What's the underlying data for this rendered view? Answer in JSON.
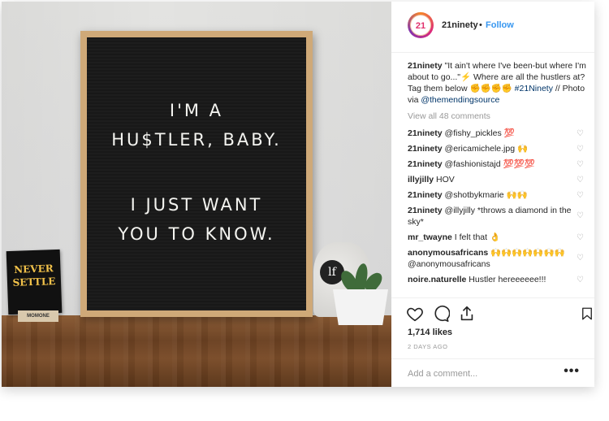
{
  "post": {
    "board_lines": [
      "I'M A",
      "HU$TLER, BABY.",
      "I JUST WANT",
      "YOU TO KNOW."
    ],
    "card_lines": [
      "NEVER",
      "SETTLE"
    ],
    "stand_label": "MOMONE",
    "bag_logo": "lf"
  },
  "header": {
    "avatar_text": "21",
    "username": "21ninety",
    "separator": "•",
    "follow_label": "Follow"
  },
  "caption": {
    "user": "21ninety",
    "text": " \"It ain't where I've been-but where I'm about to go...\"⚡ Where are all the hustlers at? Tag them below ✊✊✊✊ ",
    "hashtag": "#21Ninety",
    "text2": " // Photo via ",
    "mention": "@themendingsource"
  },
  "view_all": "View all 48 comments",
  "comments": [
    {
      "user": "21ninety",
      "text": "@fishy_pickles 💯"
    },
    {
      "user": "21ninety",
      "text": "@ericamichele.jpg 🙌"
    },
    {
      "user": "21ninety",
      "text": "@fashionistajd 💯💯💯"
    },
    {
      "user": "illyjilly",
      "text": "HOV"
    },
    {
      "user": "21ninety",
      "text": "@shotbykmarie 🙌🙌"
    },
    {
      "user": "21ninety",
      "text": "@illyjilly *throws a diamond in the sky*"
    },
    {
      "user": "mr_twayne",
      "text": "I felt that 👌"
    },
    {
      "user": "anonymousafricans",
      "text": "🙌🙌🙌🙌🙌🙌🙌 @anonymousafricans"
    },
    {
      "user": "noire.naturelle",
      "text": "Hustler hereeeeee!!!"
    }
  ],
  "likes": "1,714 likes",
  "date": "2 DAYS AGO",
  "add_comment_placeholder": "Add a comment...",
  "more_label": "•••",
  "colors": {
    "link_blue": "#3897f0",
    "muted": "#999999"
  }
}
